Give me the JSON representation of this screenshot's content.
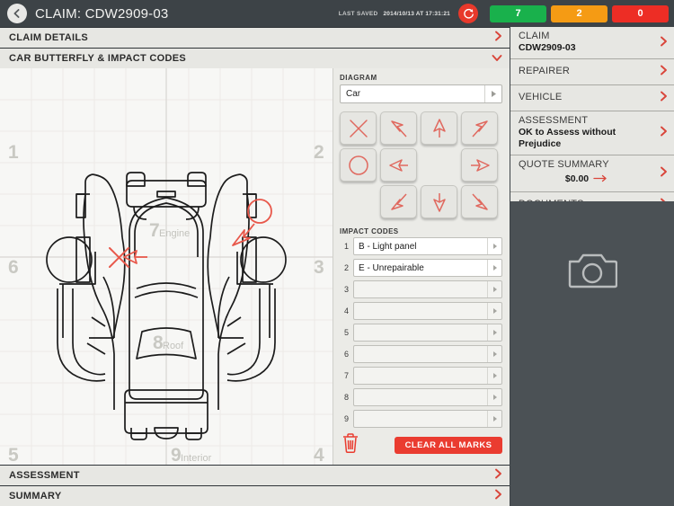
{
  "header": {
    "back_icon": "chevron-left-icon",
    "title": "CLAIM: CDW2909-03",
    "last_saved_label": "LAST SAVED",
    "last_saved_value": "2014/10/13 AT 17:31:21",
    "refresh_icon": "refresh-icon",
    "counts": [
      {
        "value": "7",
        "color": "#19b14c",
        "name": "green"
      },
      {
        "value": "2",
        "color": "#f59b14",
        "name": "amber"
      },
      {
        "value": "0",
        "color": "#ed2d25",
        "name": "red"
      }
    ]
  },
  "sections": {
    "claim_details": "CLAIM DETAILS",
    "car_butterfly": "CAR BUTTERFLY & IMPACT CODES",
    "assessment": "ASSESSMENT",
    "summary": "SUMMARY"
  },
  "diagram": {
    "label": "DIAGRAM",
    "selected": "Car",
    "zones": [
      {
        "num": "1",
        "word": ""
      },
      {
        "num": "2",
        "word": ""
      },
      {
        "num": "3",
        "word": ""
      },
      {
        "num": "4",
        "word": ""
      },
      {
        "num": "5",
        "word": ""
      },
      {
        "num": "6",
        "word": ""
      },
      {
        "num": "7",
        "word": "Engine"
      },
      {
        "num": "8",
        "word": "Roof"
      },
      {
        "num": "9",
        "word": "Interior"
      }
    ]
  },
  "tools": [
    {
      "name": "mark-cross",
      "icon": "cross-icon"
    },
    {
      "name": "mark-arrow-northwest",
      "icon": "arrow-northwest-icon"
    },
    {
      "name": "mark-arrow-up",
      "icon": "arrow-up-icon"
    },
    {
      "name": "mark-arrow-northeast",
      "icon": "arrow-northeast-icon"
    },
    {
      "name": "mark-circle",
      "icon": "circle-icon"
    },
    {
      "name": "mark-arrow-left",
      "icon": "arrow-left-icon"
    },
    {
      "name": "spacer",
      "icon": ""
    },
    {
      "name": "mark-arrow-right",
      "icon": "arrow-right-icon"
    },
    {
      "name": "spacer",
      "icon": ""
    },
    {
      "name": "mark-arrow-southwest",
      "icon": "arrow-southwest-icon"
    },
    {
      "name": "mark-arrow-down",
      "icon": "arrow-down-icon"
    },
    {
      "name": "mark-arrow-southeast",
      "icon": "arrow-southeast-icon"
    }
  ],
  "impact_codes": {
    "label": "IMPACT CODES",
    "rows": [
      {
        "index": "1",
        "value": "B - Light panel"
      },
      {
        "index": "2",
        "value": "E - Unrepairable"
      },
      {
        "index": "3",
        "value": ""
      },
      {
        "index": "4",
        "value": ""
      },
      {
        "index": "5",
        "value": ""
      },
      {
        "index": "6",
        "value": ""
      },
      {
        "index": "7",
        "value": ""
      },
      {
        "index": "8",
        "value": ""
      },
      {
        "index": "9",
        "value": ""
      }
    ],
    "delete_icon": "trash-icon",
    "clear_label": "CLEAR ALL MARKS"
  },
  "sidebar": {
    "items": [
      {
        "title": "CLAIM",
        "sub": "CDW2909-03",
        "name": "claim"
      },
      {
        "title": "REPAIRER",
        "sub": "",
        "name": "repairer"
      },
      {
        "title": "VEHICLE",
        "sub": "",
        "name": "vehicle"
      },
      {
        "title": "ASSESSMENT",
        "sub": "OK to Assess without Prejudice",
        "name": "assessment"
      },
      {
        "title": "QUOTE SUMMARY",
        "sub": "$0.00",
        "name": "quote-summary"
      },
      {
        "title": "DOCUMENTS",
        "sub": "",
        "name": "documents"
      }
    ],
    "photo_icon": "camera-icon"
  },
  "colors": {
    "accent_red": "#d9453a",
    "mark_red": "#e8584b",
    "header_bg": "#3d4347",
    "panel_bg": "#e7e7e3"
  }
}
